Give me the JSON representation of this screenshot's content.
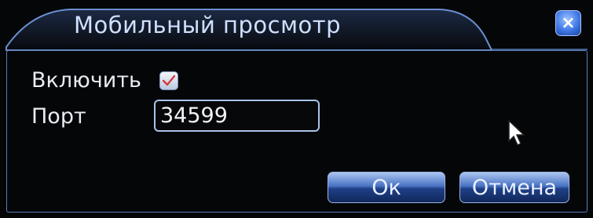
{
  "dialog": {
    "title": "Мобильный просмотр",
    "close_label": "×"
  },
  "form": {
    "enable_label": "Включить",
    "enable_checked": true,
    "port_label": "Порт",
    "port_value": "34599"
  },
  "buttons": {
    "ok_label": "Ок",
    "cancel_label": "Отмена"
  },
  "colors": {
    "accent": "#3f78e6",
    "title_text": "#cfe0ff",
    "check_mark": "#d63a3a"
  },
  "icons": {
    "close": "close-icon",
    "check": "check-icon",
    "cursor": "mouse-pointer-icon"
  }
}
